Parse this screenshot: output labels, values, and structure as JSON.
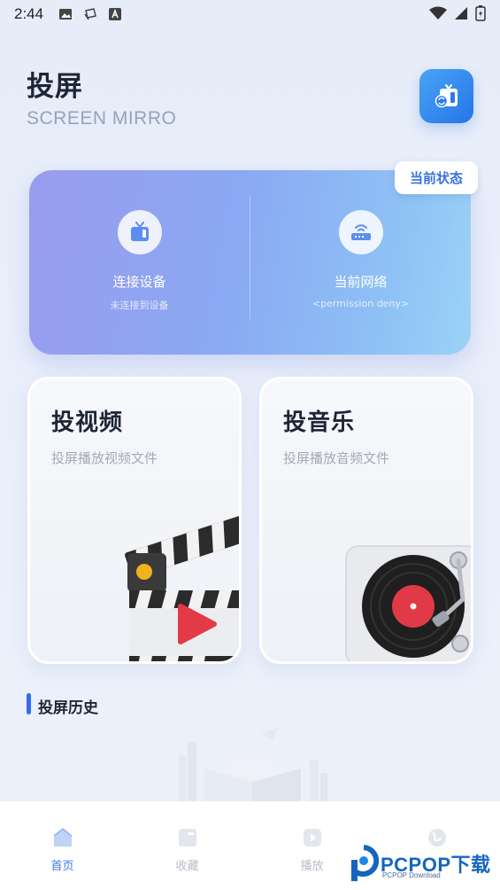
{
  "status_bar": {
    "time": "2:44"
  },
  "header": {
    "title": "投屏",
    "subtitle": "SCREEN MIRRO"
  },
  "status_card": {
    "badge": "当前状态",
    "device": {
      "label": "连接设备",
      "value": "未连接到设备",
      "icon": "tv-icon"
    },
    "network": {
      "label": "当前网络",
      "value": "<permission deny>",
      "icon": "router-icon"
    }
  },
  "features": {
    "video": {
      "title": "投视频",
      "desc": "投屏播放视频文件",
      "icon": "clapperboard-icon"
    },
    "music": {
      "title": "投音乐",
      "desc": "投屏播放音频文件",
      "icon": "turntable-icon"
    }
  },
  "history": {
    "title": "投屏历史"
  },
  "nav": {
    "items": [
      {
        "label": "首页",
        "icon": "home-icon",
        "active": true
      },
      {
        "label": "收藏",
        "icon": "collection-icon",
        "active": false
      },
      {
        "label": "播放",
        "icon": "play-icon",
        "active": false
      },
      {
        "label": "",
        "icon": "globe-icon",
        "active": false
      }
    ]
  },
  "watermark": {
    "brand": "PCPOP下载",
    "sub": "PCPOP Download"
  },
  "colors": {
    "accent": "#3b78e7",
    "brand_blue": "#2575e8",
    "card_gradient_start": "#9a9cee",
    "card_gradient_end": "#9bd3f7"
  }
}
